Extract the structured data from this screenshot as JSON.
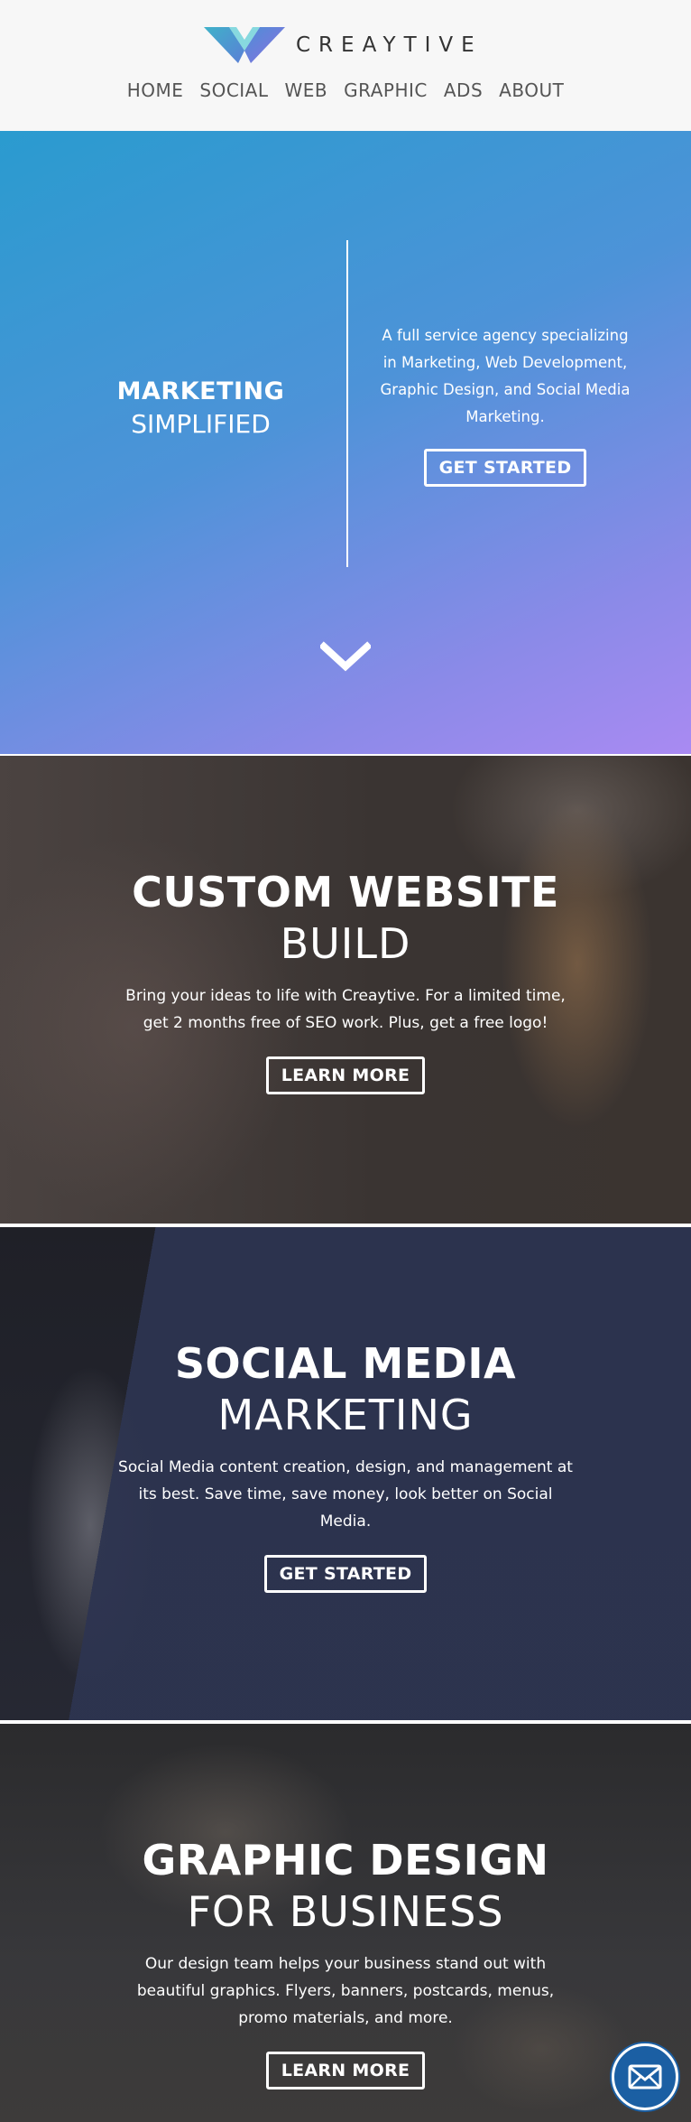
{
  "brand": {
    "name": "CREAYTIVE",
    "colors": {
      "accent": "#2a9bcf",
      "gradient_end": "#a98af2",
      "fab": "#1b5fa3"
    }
  },
  "nav": [
    "HOME",
    "SOCIAL",
    "WEB",
    "GRAPHIC",
    "ADS",
    "ABOUT"
  ],
  "hero": {
    "strong": "MARKETING",
    "light": "SIMPLIFIED",
    "description": "A full service agency specializing in Marketing, Web Development, Graphic Design, and Social Media Marketing.",
    "button": "GET STARTED",
    "scroll_icon": "chevron-down-icon"
  },
  "sections": [
    {
      "title": "CUSTOM WEBSITE",
      "subtitle": "BUILD",
      "text": "Bring your ideas to life with Creaytive. For a limited time, get 2 months free of SEO work. Plus, get a free logo!",
      "button": "LEARN MORE"
    },
    {
      "title": "SOCIAL MEDIA",
      "subtitle": "MARKETING",
      "text": "Social Media content creation, design, and management at its best. Save time, save money, look better on Social Media.",
      "button": "GET STARTED"
    },
    {
      "title": "GRAPHIC DESIGN",
      "subtitle": "FOR BUSINESS",
      "text": "Our design team helps your business stand out with beautiful graphics. Flyers, banners, postcards, menus, promo materials, and more.",
      "button": "LEARN MORE"
    }
  ],
  "fab_icon": "envelope-icon"
}
